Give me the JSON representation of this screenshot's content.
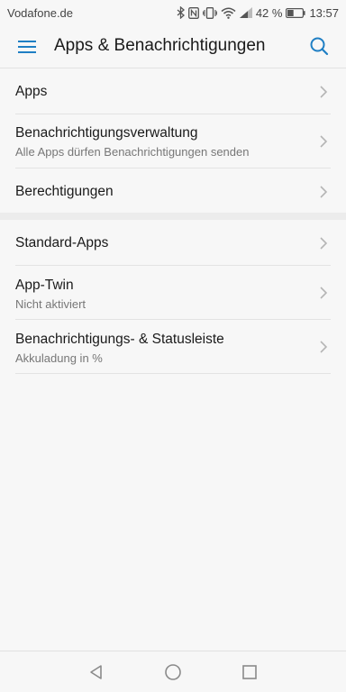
{
  "status_bar": {
    "carrier": "Vodafone.de",
    "battery_percent": "42 %",
    "time": "13:57",
    "battery_level": 0.42
  },
  "app_bar": {
    "title": "Apps & Benachrichtigungen"
  },
  "settings_group_1": [
    {
      "title": "Apps",
      "subtitle": ""
    },
    {
      "title": "Benachrichtigungsverwaltung",
      "subtitle": "Alle Apps dürfen Benachrichtigungen senden"
    },
    {
      "title": "Berechtigungen",
      "subtitle": ""
    }
  ],
  "settings_group_2": [
    {
      "title": "Standard-Apps",
      "subtitle": ""
    },
    {
      "title": "App-Twin",
      "subtitle": "Nicht aktiviert"
    },
    {
      "title": "Benachrichtigungs- & Statusleiste",
      "subtitle": "Akkuladung in %"
    }
  ],
  "colors": {
    "accent": "#1f7fc4",
    "background": "#f7f7f7",
    "divider": "#e3e3e3",
    "subtitle": "#777777"
  },
  "icons": {
    "menu": "hamburger-menu-icon",
    "search": "search-icon",
    "chevron": "chevron-right-icon",
    "back": "back-triangle-icon",
    "home": "home-circle-icon",
    "recents": "recents-square-icon"
  }
}
